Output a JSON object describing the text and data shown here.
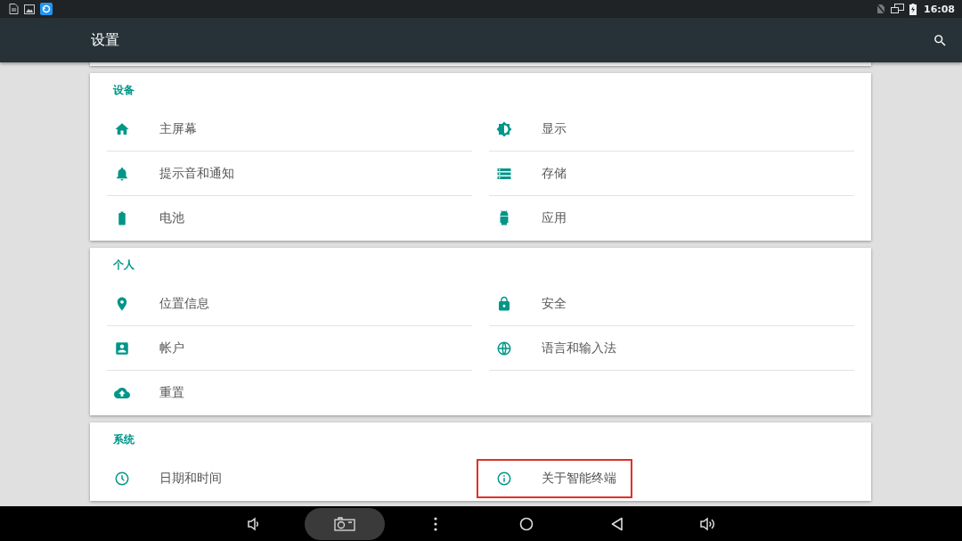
{
  "status_bar": {
    "time": "16:08"
  },
  "app_bar": {
    "title": "设置"
  },
  "sections": [
    {
      "title": "设备",
      "items": [
        {
          "label": "主屏幕",
          "highlighted": false
        },
        {
          "label": "显示",
          "highlighted": false
        },
        {
          "label": "提示音和通知",
          "highlighted": false
        },
        {
          "label": "存储",
          "highlighted": false
        },
        {
          "label": "电池",
          "highlighted": false
        },
        {
          "label": "应用",
          "highlighted": false
        }
      ]
    },
    {
      "title": "个人",
      "items": [
        {
          "label": "位置信息",
          "highlighted": false
        },
        {
          "label": "安全",
          "highlighted": false
        },
        {
          "label": "帐户",
          "highlighted": false
        },
        {
          "label": "语言和输入法",
          "highlighted": false
        },
        {
          "label": "重置",
          "highlighted": false
        }
      ]
    },
    {
      "title": "系统",
      "items": [
        {
          "label": "日期和时间",
          "highlighted": false
        },
        {
          "label": "关于智能终端",
          "highlighted": true
        }
      ]
    }
  ]
}
